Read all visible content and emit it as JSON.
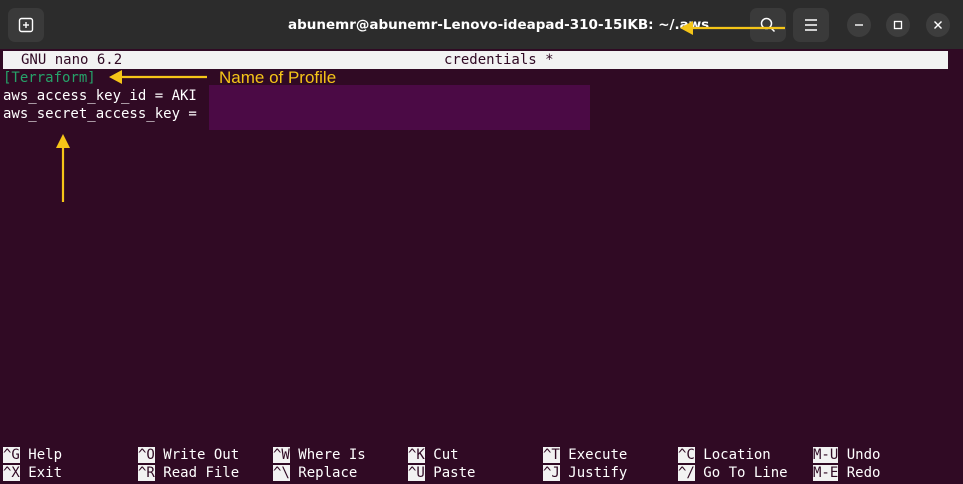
{
  "window": {
    "title": "abunemr@abunemr-Lenovo-ideapad-310-15IKB: ~/.aws",
    "icons": [
      "new-tab-icon",
      "search-icon",
      "menu-icon",
      "minimize-icon",
      "maximize-icon",
      "close-icon"
    ]
  },
  "nano": {
    "version": "GNU nano 6.2",
    "filename": "credentials *"
  },
  "file": {
    "profile": "[Terraform]",
    "access_key_line": "aws_access_key_id = AKI",
    "secret_key_line": "aws_secret_access_key ="
  },
  "shortcuts": [
    {
      "key": "^G",
      "label": "Help"
    },
    {
      "key": "^X",
      "label": "Exit"
    },
    {
      "key": "^O",
      "label": "Write Out"
    },
    {
      "key": "^R",
      "label": "Read File"
    },
    {
      "key": "^W",
      "label": "Where Is"
    },
    {
      "key": "^\\",
      "label": "Replace"
    },
    {
      "key": "^K",
      "label": "Cut"
    },
    {
      "key": "^U",
      "label": "Paste"
    },
    {
      "key": "^T",
      "label": "Execute"
    },
    {
      "key": "^J",
      "label": "Justify"
    },
    {
      "key": "^C",
      "label": "Location"
    },
    {
      "key": "^/",
      "label": "Go To Line"
    },
    {
      "key": "M-U",
      "label": "Undo"
    },
    {
      "key": "M-E",
      "label": "Redo"
    }
  ],
  "annotations": {
    "profile_label": "Name of Profile",
    "color": "#f5c518"
  },
  "colors": {
    "terminal_bg": "#300a24",
    "titlebar_bg": "#2c2c2c",
    "profile_text": "#26a269"
  }
}
